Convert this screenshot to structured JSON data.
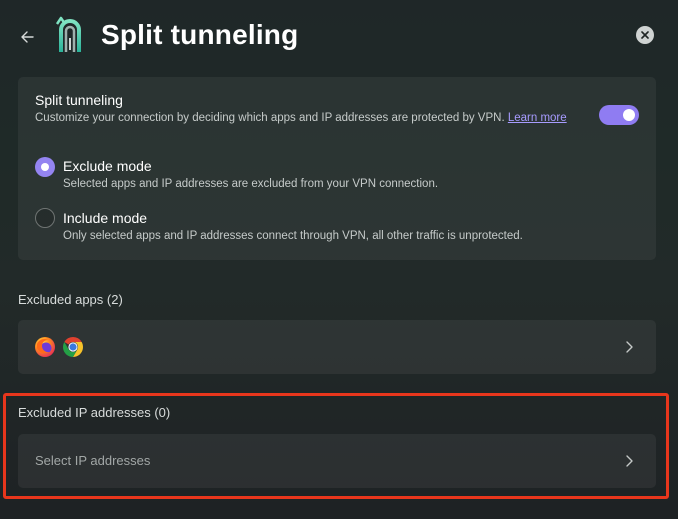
{
  "header": {
    "title": "Split tunneling",
    "back_icon": "arrow-left-icon",
    "logo_icon": "app-logo-icon",
    "close_icon": "close-icon"
  },
  "split_tunneling": {
    "title": "Split tunneling",
    "description": "Customize your connection by deciding which apps and IP addresses are protected by VPN.",
    "learn_more": "Learn more",
    "enabled": true,
    "modes": [
      {
        "label": "Exclude mode",
        "description": "Selected apps and IP addresses are excluded from your VPN connection.",
        "selected": true
      },
      {
        "label": "Include mode",
        "description": "Only selected apps and IP addresses connect through VPN, all other traffic is unprotected.",
        "selected": false
      }
    ]
  },
  "excluded_apps": {
    "label": "Excluded apps (2)",
    "apps": [
      "firefox-icon",
      "chrome-icon"
    ]
  },
  "excluded_ips": {
    "label": "Excluded IP addresses (0)",
    "placeholder": "Select IP addresses"
  },
  "colors": {
    "accent": "#8f7cf2",
    "link": "#a79bff",
    "highlight": "#e8361c"
  }
}
